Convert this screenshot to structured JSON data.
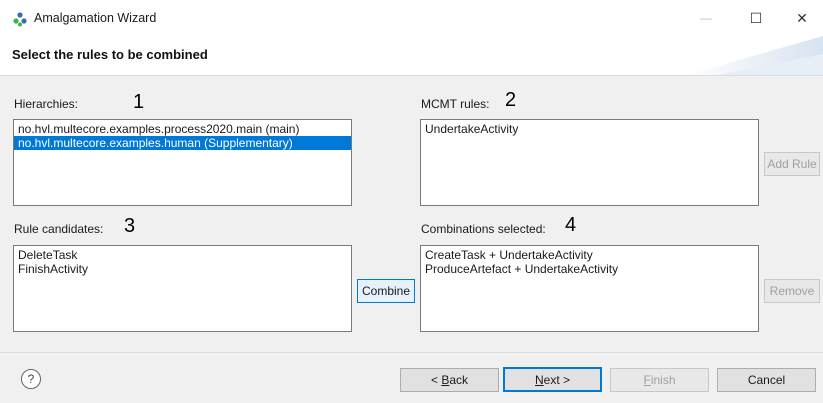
{
  "window": {
    "title": "Amalgamation Wizard",
    "minimize_glyph": "—",
    "maximize_glyph": "☐",
    "close_glyph": "✕"
  },
  "header": {
    "title": "Select the rules to be combined"
  },
  "hierarchies": {
    "label": "Hierarchies:",
    "annotation": "1",
    "items": [
      {
        "text": "no.hvl.multecore.examples.process2020.main (main)",
        "selected": false
      },
      {
        "text": "no.hvl.multecore.examples.human (Supplementary)",
        "selected": true
      }
    ]
  },
  "mcmt_rules": {
    "label": "MCMT rules:",
    "annotation": "2",
    "items": [
      "UndertakeActivity"
    ],
    "add_button": "Add Rule"
  },
  "rule_candidates": {
    "label": "Rule candidates:",
    "annotation": "3",
    "items": [
      "DeleteTask",
      "FinishActivity"
    ],
    "combine_button": "Combine"
  },
  "combinations": {
    "label": "Combinations selected:",
    "annotation": "4",
    "items": [
      "CreateTask + UndertakeActivity",
      "ProduceArtefact + UndertakeActivity"
    ],
    "remove_button": "Remove"
  },
  "footer": {
    "help_glyph": "?",
    "back_prefix": "< ",
    "back_mnemonic": "B",
    "back_rest": "ack",
    "next_mnemonic": "N",
    "next_rest": "ext >",
    "finish_mnemonic": "F",
    "finish_rest": "inish",
    "cancel": "Cancel"
  },
  "colors": {
    "selection": "#0078d7",
    "background": "#f0f0f0",
    "icon_blue": "#2f6fb5",
    "icon_green": "#3bb54a"
  }
}
